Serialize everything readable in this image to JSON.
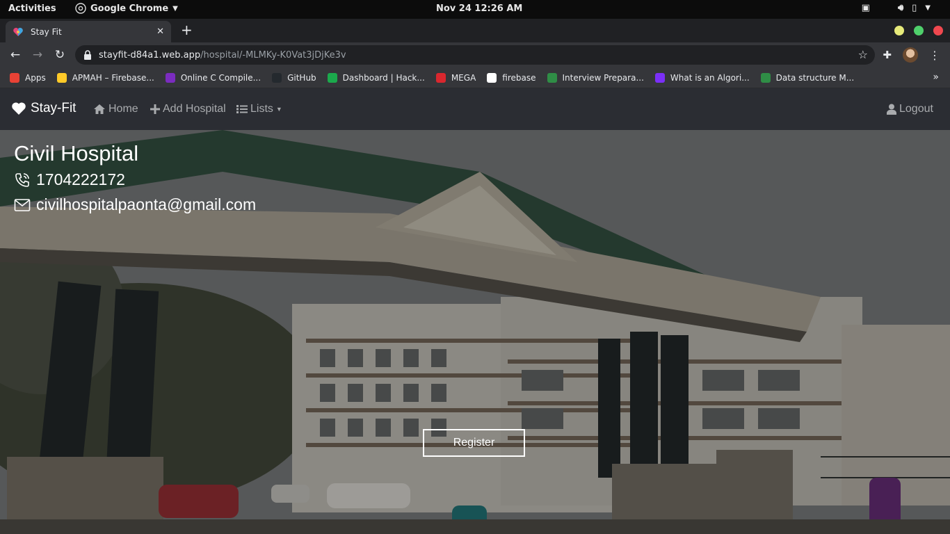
{
  "system_bar": {
    "activities": "Activities",
    "app_name": "Google Chrome",
    "datetime": "Nov 24  12:26 AM"
  },
  "browser": {
    "tab_title": "Stay Fit",
    "url_host": "stayfit-d84a1.web.app",
    "url_path": "/hospital/-MLMKy-K0Vat3jDjKe3v",
    "bookmarks": [
      {
        "label": "Apps",
        "icon": "apps-grid-icon",
        "color": "#e94235"
      },
      {
        "label": "APMAH – Firebase...",
        "icon": "firebase-icon",
        "color": "#ffca28"
      },
      {
        "label": "Online C Compile...",
        "icon": "bolt-icon",
        "color": "#7b2cbf"
      },
      {
        "label": "GitHub",
        "icon": "github-icon",
        "color": "#24292e"
      },
      {
        "label": "Dashboard | Hack...",
        "icon": "hackerrank-icon",
        "color": "#1ba94c"
      },
      {
        "label": "MEGA",
        "icon": "mega-icon",
        "color": "#d9272e"
      },
      {
        "label": "firebase",
        "icon": "globe-icon",
        "color": "#ffffff"
      },
      {
        "label": "Interview Prepara...",
        "icon": "gfg-icon",
        "color": "#2f8d46"
      },
      {
        "label": "What is an Algori...",
        "icon": "question-icon",
        "color": "#7b2ff7"
      },
      {
        "label": "Data structure M...",
        "icon": "gfg-circle-icon",
        "color": "#2f8d46"
      }
    ]
  },
  "navbar": {
    "brand": "Stay-Fit",
    "home": "Home",
    "add_hospital": "Add Hospital",
    "lists": "Lists",
    "logout": "Logout"
  },
  "hospital": {
    "name": "Civil Hospital",
    "phone": "1704222172",
    "email": "civilhospitalpaonta@gmail.com",
    "register_label": "Register"
  }
}
